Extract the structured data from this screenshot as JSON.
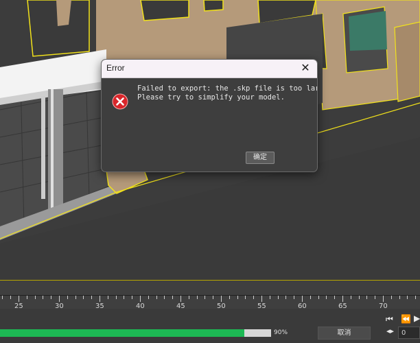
{
  "dialog": {
    "title": "Error",
    "message_line1": "Failed to export: the .skp file is too large.",
    "message_line2": "Please try to simplify your model.",
    "ok_label": "确定",
    "close_glyph": "✕",
    "error_color": "#d8262b"
  },
  "timeline": {
    "labels": [
      "25",
      "30",
      "35",
      "40",
      "45",
      "50",
      "55",
      "60",
      "65",
      "70"
    ],
    "accent_color": "#b7a600"
  },
  "statusbar": {
    "progress": 0.9,
    "progress_label": "90%",
    "progress_color": "#1db954",
    "cancel_label": "取消",
    "frame_value": "0"
  },
  "playback": {
    "icons": [
      "skip-to-start-icon",
      "step-back-icon",
      "play-icon",
      "step-frame-icon"
    ]
  }
}
